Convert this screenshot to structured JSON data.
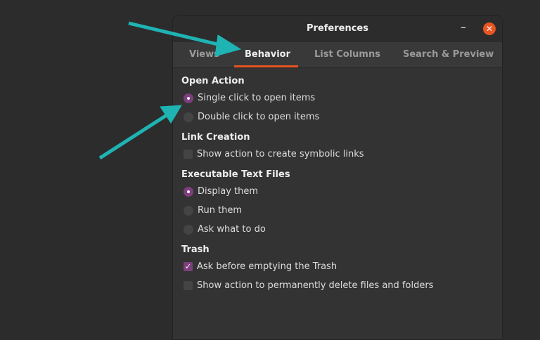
{
  "window": {
    "title": "Preferences",
    "minimize": "–",
    "close": "✕"
  },
  "tabs": [
    {
      "label": "Views"
    },
    {
      "label": "Behavior"
    },
    {
      "label": "List Columns"
    },
    {
      "label": "Search & Preview"
    }
  ],
  "sections": {
    "open_action": {
      "heading": "Open Action",
      "options": [
        {
          "label": "Single click to open items",
          "checked": true
        },
        {
          "label": "Double click to open items",
          "checked": false
        }
      ]
    },
    "link_creation": {
      "heading": "Link Creation",
      "options": [
        {
          "label": "Show action to create symbolic links",
          "checked": false
        }
      ]
    },
    "executable": {
      "heading": "Executable Text Files",
      "options": [
        {
          "label": "Display them",
          "checked": true
        },
        {
          "label": "Run them",
          "checked": false
        },
        {
          "label": "Ask what to do",
          "checked": false
        }
      ]
    },
    "trash": {
      "heading": "Trash",
      "options": [
        {
          "label": "Ask before emptying the Trash",
          "checked": true
        },
        {
          "label": "Show action to permanently delete files and folders",
          "checked": false
        }
      ]
    }
  },
  "colors": {
    "accent": "#e95420",
    "selected": "#7c3f7c",
    "annotation": "#1fb3b3"
  }
}
